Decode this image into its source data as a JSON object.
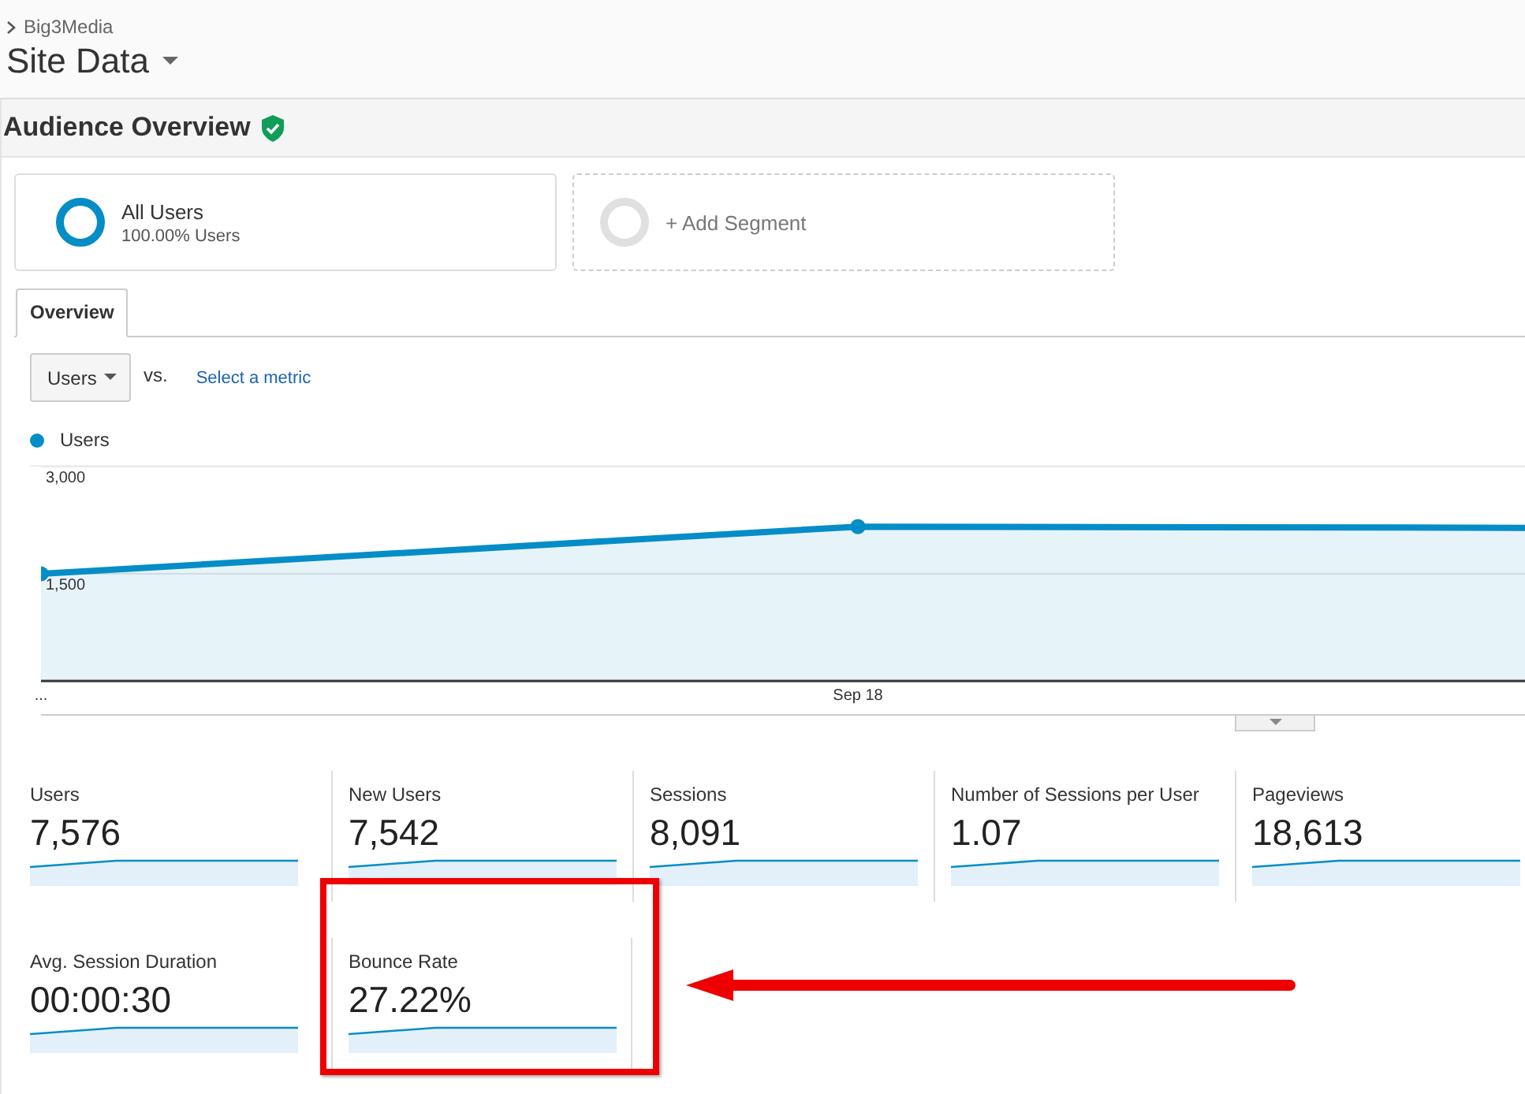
{
  "breadcrumb": {
    "account": "Big3Media"
  },
  "view": {
    "title": "Site Data"
  },
  "report": {
    "title": "Audience Overview",
    "verified": true
  },
  "segments": [
    {
      "kind": "active",
      "name": "All Users",
      "detail": "100.00% Users"
    },
    {
      "kind": "add",
      "name": "+ Add Segment"
    }
  ],
  "tabs": [
    {
      "label": "Overview",
      "selected": true
    }
  ],
  "metric_picker": {
    "value": "Users",
    "vs": "vs.",
    "link": "Select a metric"
  },
  "chart": {
    "chart_data": {
      "type": "area",
      "categories": [
        "...",
        "Sep 18",
        null
      ],
      "series": [
        {
          "name": "Users",
          "color": "#058dc7",
          "values": [
            1500,
            2160,
            2140
          ]
        }
      ],
      "ylim": [
        0,
        3000
      ],
      "yticks": [
        {
          "value": 3000,
          "label": "3,000"
        },
        {
          "value": 1500,
          "label": "1,500"
        }
      ]
    }
  },
  "metrics": [
    {
      "label": "Users",
      "value": "7,576",
      "highlighted": false
    },
    {
      "label": "New Users",
      "value": "7,542",
      "highlighted": false
    },
    {
      "label": "Sessions",
      "value": "8,091",
      "highlighted": false
    },
    {
      "label": "Number of Sessions per User",
      "value": "1.07",
      "highlighted": false
    },
    {
      "label": "Pageviews",
      "value": "18,613",
      "highlighted": false
    },
    {
      "label": "Avg. Session Duration",
      "value": "00:00:30",
      "highlighted": false
    },
    {
      "label": "Bounce Rate",
      "value": "27.22%",
      "highlighted": true
    }
  ]
}
